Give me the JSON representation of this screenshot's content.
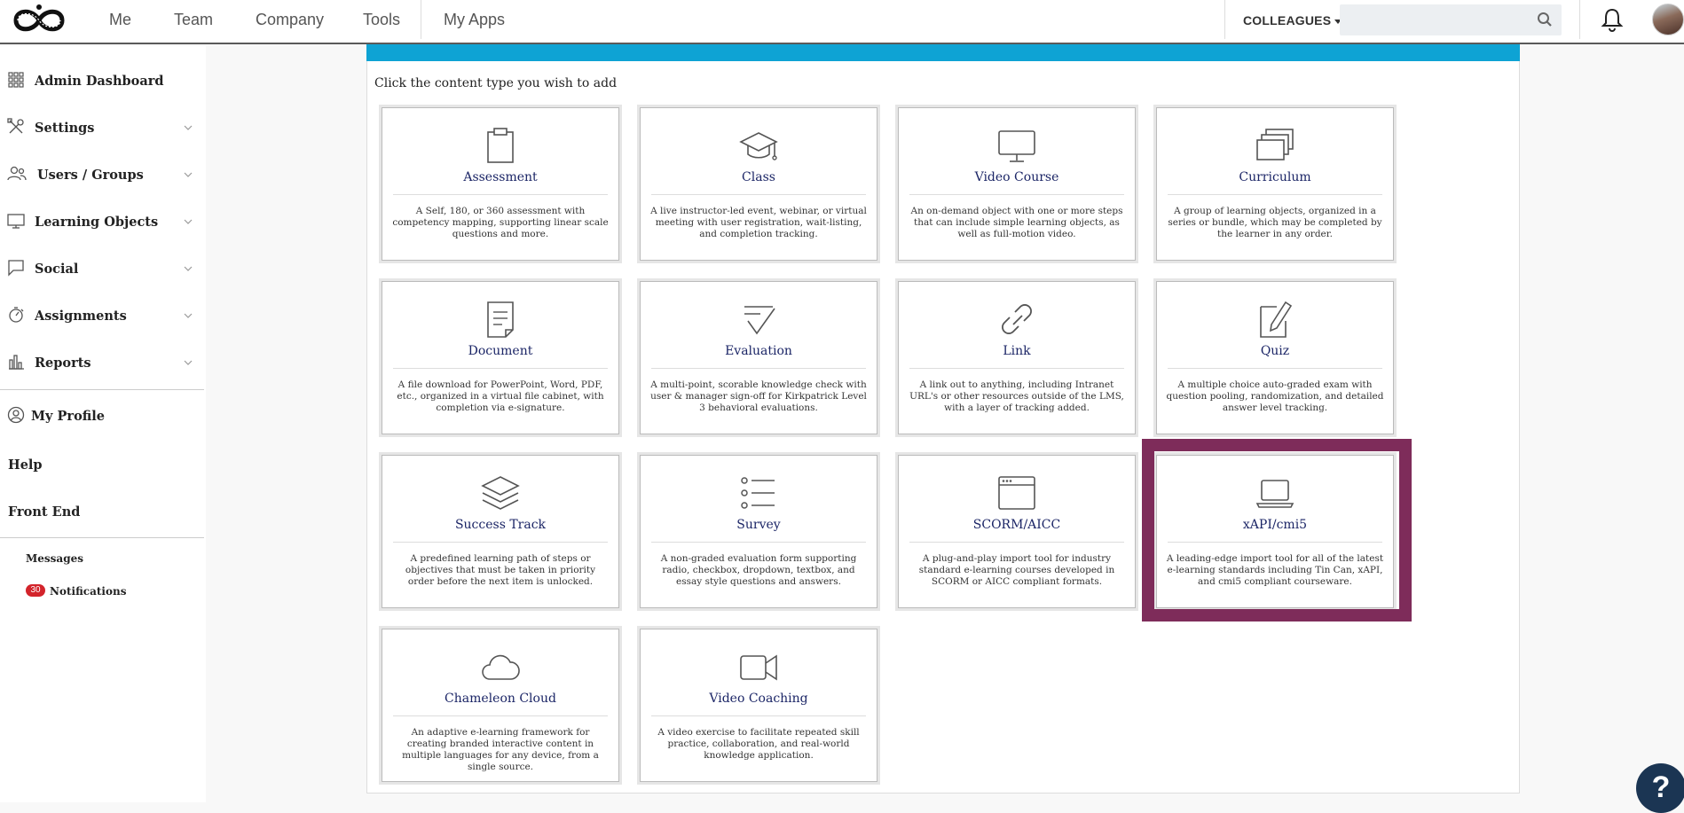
{
  "topnav": {
    "items": [
      "Me",
      "Team",
      "Company",
      "Tools",
      "My Apps"
    ],
    "colleagues_label": "COLLEAGUES",
    "search_placeholder": ""
  },
  "sidebar": {
    "items": [
      {
        "label": "Admin Dashboard",
        "icon": "grid-icon"
      },
      {
        "label": "Settings",
        "icon": "tools-icon"
      },
      {
        "label": "Users / Groups",
        "icon": "users-icon"
      },
      {
        "label": "Learning Objects",
        "icon": "monitor-icon"
      },
      {
        "label": "Social",
        "icon": "chat-icon"
      },
      {
        "label": "Assignments",
        "icon": "stopwatch-icon"
      },
      {
        "label": "Reports",
        "icon": "bar-chart-icon"
      }
    ],
    "my_profile": "My Profile",
    "help": "Help",
    "front_end": "Front End",
    "messages": "Messages",
    "notifications": "Notifications",
    "notifications_count": "30"
  },
  "main": {
    "instruction": "Click the content type you wish to add",
    "cards": [
      {
        "title": "Assessment",
        "icon": "clipboard-icon",
        "desc": "A Self, 180, or 360 assessment with competency mapping, supporting linear scale questions and more."
      },
      {
        "title": "Class",
        "icon": "graduation-cap-icon",
        "desc": "A live instructor-led event, webinar, or virtual meeting with user registration, wait-listing, and completion tracking."
      },
      {
        "title": "Video Course",
        "icon": "monitor-icon",
        "desc": "An on-demand object with one or more steps that can include simple learning objects, as well as full-motion video."
      },
      {
        "title": "Curriculum",
        "icon": "stacked-windows-icon",
        "desc": "A group of learning objects, organized in a series or bundle, which may be completed by the learner in any order."
      },
      {
        "title": "Document",
        "icon": "document-icon",
        "desc": "A file download for PowerPoint, Word, PDF, etc., organized in a virtual file cabinet, with completion via e-signature."
      },
      {
        "title": "Evaluation",
        "icon": "checklist-icon",
        "desc": "A multi-point, scorable knowledge check with user & manager sign-off for Kirkpatrick Level 3 behavioral evaluations."
      },
      {
        "title": "Link",
        "icon": "link-icon",
        "desc": "A link out to anything, including Intranet URL's or other resources outside of the LMS, with a layer of tracking added."
      },
      {
        "title": "Quiz",
        "icon": "pencil-document-icon",
        "desc": "A multiple choice auto-graded exam with question pooling, randomization, and detailed answer level tracking."
      },
      {
        "title": "Success Track",
        "icon": "layers-icon",
        "desc": "A predefined learning path of steps or objectives that must be taken in priority order before the next item is unlocked."
      },
      {
        "title": "Survey",
        "icon": "list-icon",
        "desc": "A non-graded evaluation form supporting radio, checkbox, dropdown, textbox, and essay style questions and answers."
      },
      {
        "title": "SCORM/AICC",
        "icon": "browser-window-icon",
        "desc": "A plug-and-play import tool for industry standard e-learning courses developed in SCORM or AICC compliant formats."
      },
      {
        "title": "xAPI/cmi5",
        "icon": "laptop-icon",
        "desc": "A leading-edge import tool for all of the latest e-learning standards including Tin Can, xAPI, and cmi5 compliant courseware."
      },
      {
        "title": "Chameleon Cloud",
        "icon": "cloud-icon",
        "desc": "An adaptive e-learning framework for creating branded interactive content in multiple languages for any device, from a single source."
      },
      {
        "title": "Video Coaching",
        "icon": "video-camera-icon",
        "desc": "A video exercise to facilitate repeated skill practice, collaboration, and real-world knowledge application."
      }
    ]
  },
  "help_button": "?",
  "colors": {
    "accent_bar": "#0ea3d4",
    "highlight": "#7e2c5a",
    "title": "#1b2566",
    "badge": "#d3242b"
  }
}
